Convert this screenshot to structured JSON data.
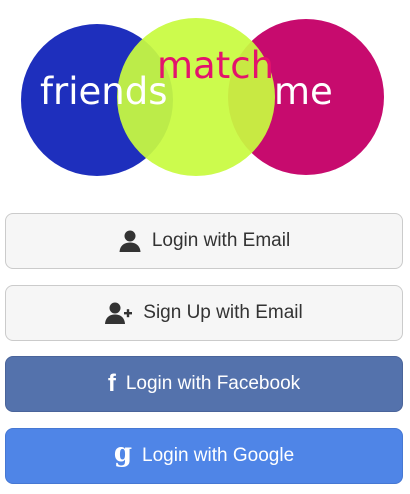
{
  "logo": {
    "word_left": "friends",
    "word_center": "match",
    "word_right": "me",
    "colors": {
      "left_circle": "#1e2fbd",
      "center_circle": "#c8fb3f",
      "right_circle": "#c70b6e",
      "center_text": "#e3136d"
    }
  },
  "buttons": {
    "email_login": {
      "label": "Login with Email",
      "icon": "user-icon"
    },
    "email_signup": {
      "label": "Sign Up with Email",
      "icon": "user-plus-icon"
    },
    "facebook_login": {
      "label": "Login with Facebook",
      "icon": "facebook-icon",
      "color": "#5472ac"
    },
    "google_login": {
      "label": "Login with Google",
      "icon": "google-icon",
      "color": "#4f85e7"
    }
  }
}
